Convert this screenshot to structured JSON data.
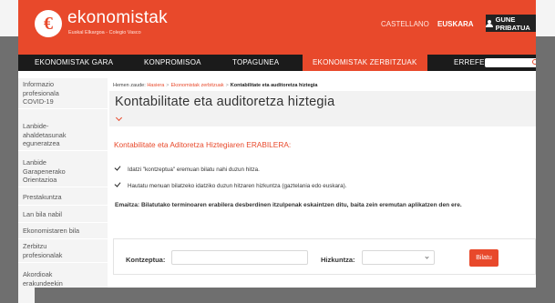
{
  "header": {
    "logo_mark": "€",
    "logo_name": "ekonomistak",
    "logo_sub": "Euskal Elkargoa - Colegio Vasco",
    "lang_es": "CASTELLANO",
    "lang_eu": "EUSKARA",
    "private_area": "GUNE PRIBATUA"
  },
  "nav": {
    "items": [
      {
        "label": "EKONOMISTAK GARA"
      },
      {
        "label": "KONPROMISOA"
      },
      {
        "label": "TOPAGUNEA"
      },
      {
        "label": "EKONOMISTAK ZERBITZUAK"
      },
      {
        "label": "ERREFER"
      }
    ],
    "active_index": 3
  },
  "sidebar": {
    "items": [
      {
        "lines": [
          "Informazio",
          "profesionala",
          "COVID-19"
        ]
      },
      {
        "lines": [
          "Lanbide-",
          "ahaldetasunak",
          "eguneratzea"
        ]
      },
      {
        "lines": [
          "Lanbide",
          "Garapenerako",
          "Orientazioa"
        ]
      },
      {
        "lines": [
          "Prestakuntza"
        ]
      },
      {
        "lines": [
          "Lan bila nabil"
        ]
      },
      {
        "lines": [
          "Ekonomistaren bila"
        ]
      },
      {
        "lines": [
          "Zerbitzu",
          "profesionalak"
        ]
      },
      {
        "lines": [
          "Akordioak",
          "erakundeekin"
        ]
      }
    ]
  },
  "breadcrumb": {
    "prefix": "Hemen zaude:",
    "home": "Hasiera",
    "section": "Ekonomistak zerbitzuak",
    "current": "Kontabilitate eta auditoretza hiztegia"
  },
  "page": {
    "title": "Kontabilitate eta auditoretza hiztegia",
    "section_heading": "Kontabilitate eta Aditoretza Hiztegiaren ERABILERA:",
    "bullets": [
      "Idatzi \"kontzeptua\" eremuan bilatu nahi duzun hitza.",
      "Hautatu menuan bilatzeko idatziko duzun hitzaren hizkuntza (gaztelania edo euskara)."
    ],
    "note": "Emaitza: Bilatutako terminoaren erabilera desberdinen itzulpenak eskaintzen ditu, baita zein eremutan aplikatzen den ere."
  },
  "form": {
    "concept_label": "Kontzeptua:",
    "concept_value": "",
    "language_label": "Hizkuntza:",
    "language_value": "",
    "submit_label": "Bilatu"
  },
  "colors": {
    "accent": "#e8492b",
    "nav_bg": "#1b1b1b",
    "sidebar_bg": "#f4f4f4"
  }
}
